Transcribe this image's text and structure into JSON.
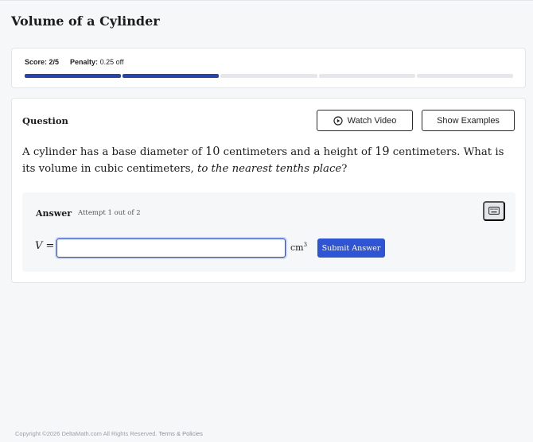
{
  "page": {
    "title": "Volume of a Cylinder"
  },
  "score": {
    "score_label": "Score:",
    "score_value": "2/5",
    "penalty_label": "Penalty:",
    "penalty_value": "0.25 off",
    "progress_completed": 2,
    "progress_total": 5,
    "progress_color": "#2745a8"
  },
  "question": {
    "label": "Question",
    "watch_video_label": "Watch Video",
    "show_examples_label": "Show Examples",
    "text_a": "A cylinder has a base diameter of ",
    "diameter": "10",
    "text_b": " centimeters and a height of ",
    "height": "19",
    "text_c": " centimeters. What is its volume in cubic centimeters, ",
    "text_italic": "to the nearest tenths place",
    "text_d": "?"
  },
  "answer": {
    "label": "Answer",
    "attempt": "Attempt 1 out of 2",
    "variable": "V",
    "equals": "=",
    "input_value": "",
    "unit": "cm",
    "unit_exp": "3",
    "submit_label": "Submit Answer",
    "keyboard_icon": "keyboard-icon"
  },
  "footer": {
    "copyright": "Copyright ©2026 DeltaMath.com All Rights Reserved.",
    "terms_link": "Terms & Policies"
  },
  "colors": {
    "accent": "#2f55d4",
    "progress": "#2745a8",
    "background": "#f6f7f9"
  }
}
